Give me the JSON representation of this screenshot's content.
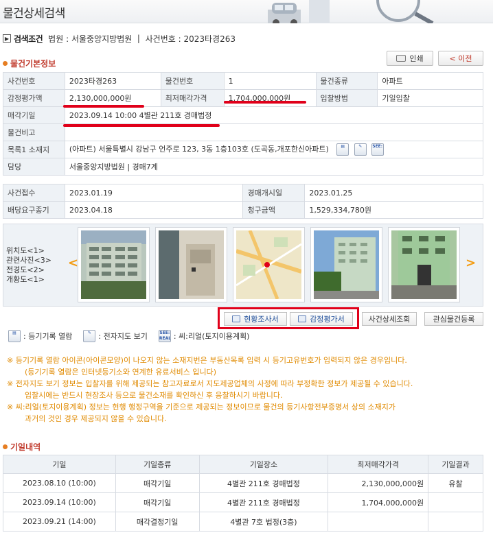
{
  "header": {
    "title": "물건상세검색"
  },
  "search": {
    "title": "검색조건",
    "court_label": "법원 :",
    "court": "서울중앙지방법원",
    "sep": "|",
    "case_label": "사건번호 :",
    "case_no": "2023타경263"
  },
  "toolbar": {
    "print_label": "인쇄",
    "back_label": "< 이전"
  },
  "basic": {
    "title": "물건기본정보",
    "labels": {
      "case_no": "사건번호",
      "item_no": "물건번호",
      "item_type": "물건종류",
      "appraisal": "감정평가액",
      "min_price": "최저매각가격",
      "bid_method": "입찰방법",
      "sale_date": "매각기일",
      "remarks": "물건비고",
      "location": "목록1 소재지",
      "manager": "담당"
    },
    "values": {
      "case_no": "2023타경263",
      "item_no": "1",
      "item_type": "아파트",
      "appraisal": "2,130,000,000원",
      "min_price": "1,704,000,000원",
      "bid_method": "기일입찰",
      "sale_date": "2023.09.14 10:00 4별관 211호 경매법정",
      "remarks": "",
      "location": "(아파트) 서울특별시 강남구 언주로 123, 3동 1층103호 (도곡동,개포한신아파트)",
      "manager": "서울중앙지방법원 | 경매7계"
    }
  },
  "case_info": {
    "labels": {
      "received": "사건접수",
      "start": "경매개시일",
      "deadline": "배당요구종기",
      "claim": "청구금액"
    },
    "values": {
      "received": "2023.01.19",
      "start": "2023.01.25",
      "deadline": "2023.04.18",
      "claim": "1,529,334,780원"
    }
  },
  "photos": {
    "legend": [
      "위치도<1>",
      "관련사진<3>",
      "전경도<2>",
      "개황도<1>"
    ],
    "prev_label": "<",
    "next_label": ">"
  },
  "actions": {
    "status_report": "현황조사서",
    "appraisal_report": "감정평가서",
    "case_detail": "사건상세조회",
    "interest": "관심물건등록"
  },
  "icon_legend": {
    "registry": ": 등기기록 열람",
    "map": ": 전자지도 보기",
    "seereal": ": 씨:리얼(토지이용계획)",
    "seereal_icon_text": "SEE: REAL"
  },
  "notes": [
    "※ 등기기록 열람 아이콘(아이콘모양)이 나오지 않는 소재지번은 부동산목록 입력 시 등기고유번호가 입력되지 않은 경우입니다.",
    "(등기기록 열람은 인터넷등기소와 연계한 유료서비스 입니다)",
    "※ 전자지도 보기 정보는 입찰자를 위해 제공되는 참고자료로서 지도제공업체의 사정에 따라 부정확한 정보가 제공될 수 있습니다.",
    "입찰시에는 반드시 현장조사 등으로 물건소재를 확인하신 후 응찰하시기 바랍니다.",
    "※ 씨:리얼(토지이용계획) 정보는 현행 행정구역을 기준으로 제공되는 정보이므로 물건의 등기사항전부증명서 상의 소재지가",
    "과거의 것인 경우 제공되지 않을 수 있습니다."
  ],
  "schedule": {
    "title": "기일내역",
    "headers": [
      "기일",
      "기일종류",
      "기일장소",
      "최저매각가격",
      "기일결과"
    ],
    "rows": [
      [
        "2023.08.10 (10:00)",
        "매각기일",
        "4별관 211호 경매법정",
        "2,130,000,000원",
        "유찰"
      ],
      [
        "2023.09.14 (10:00)",
        "매각기일",
        "4별관 211호 경매법정",
        "1,704,000,000원",
        ""
      ],
      [
        "2023.09.21 (14:00)",
        "매각결정기일",
        "4별관 7호 법정(3층)",
        "",
        ""
      ]
    ]
  },
  "colors": {
    "accent_red": "#e0001a",
    "note_orange": "#e08a00",
    "section_red": "#c0392b",
    "label_bg": "#eef2f6"
  }
}
